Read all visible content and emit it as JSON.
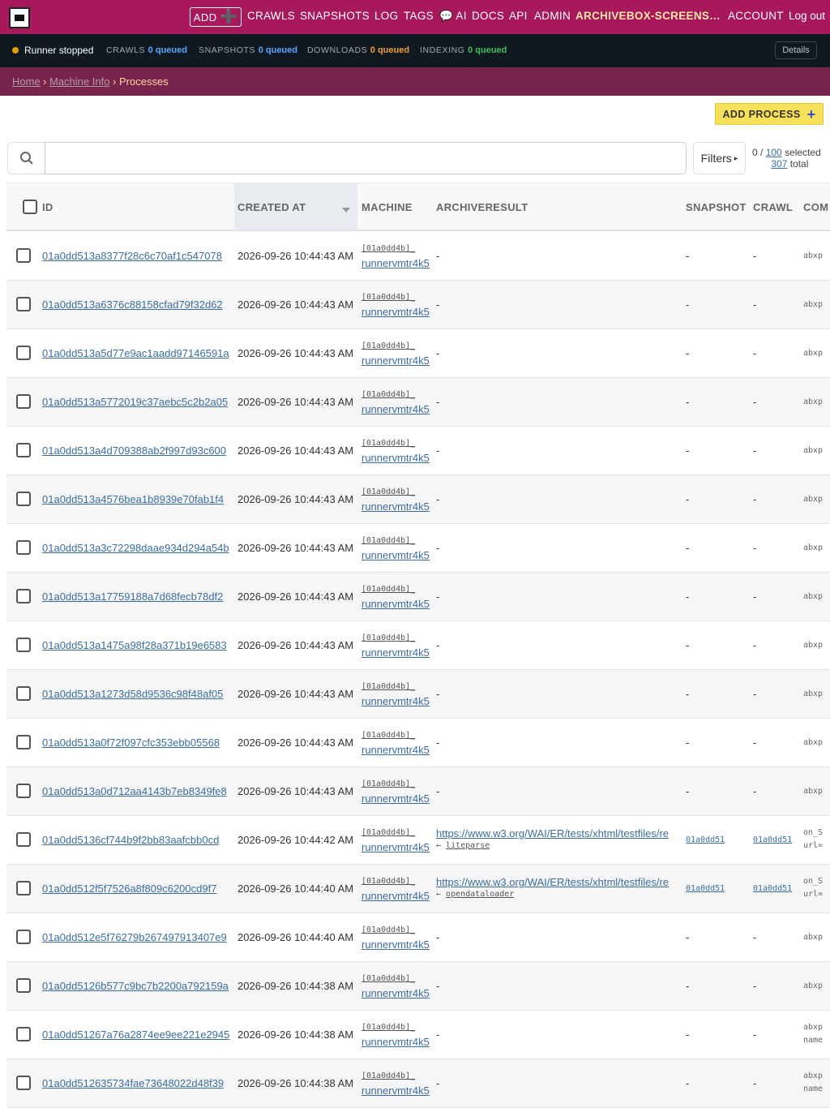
{
  "nav": {
    "add_label": "ADD",
    "add_plus": "➕",
    "links": [
      "CRAWLS",
      "SNAPSHOTS",
      "LOG",
      "TAGS",
      "💬 AI",
      "DOCS",
      "API",
      "ADMIN"
    ],
    "brand": "ARCHIVEBOX-SCREENS…",
    "account": "ACCOUNT",
    "logout": "Log out"
  },
  "status": {
    "runner": "Runner stopped",
    "crawls_label": "CRAWLS",
    "crawls_value": "0 queued",
    "snapshots_label": "SNAPSHOTS",
    "snapshots_value": "0 queued",
    "downloads_label": "DOWNLOADS",
    "downloads_value": "0 queued",
    "indexing_label": "INDEXING",
    "indexing_value": "0 queued",
    "details": "Details"
  },
  "breadcrumb": {
    "home": "Home",
    "sep": "›",
    "machine": "Machine Info",
    "current": "Processes"
  },
  "actions": {
    "add_process": "ADD PROCESS",
    "add_plus": "+"
  },
  "search": {
    "value": "",
    "placeholder": ""
  },
  "filters": {
    "label": "Filters",
    "arrow": "▸"
  },
  "selection": {
    "selected_prefix": "0 /",
    "page_size": "100",
    "selected_suffix": "selected",
    "total": "307",
    "total_suffix": "total"
  },
  "table": {
    "columns": [
      "ID",
      "CREATED AT",
      "MACHINE",
      "ARCHIVERESULT",
      "SNAPSHOT",
      "CRAWL",
      "COM"
    ],
    "rows": [
      {
        "id": "01a0dd513a8377f28c6c70af1c547078",
        "created": "2026-09-26 10:44:43 AM",
        "machine_id": "[01a0dd4b]_",
        "machine_name": "runnervmtr4k5",
        "archiveresult": "-",
        "hook": "",
        "snapshot": "-",
        "crawl": "-",
        "cmd1": "abxp",
        "cmd2": ""
      },
      {
        "id": "01a0dd513a6376c88158cfad79f32d62",
        "created": "2026-09-26 10:44:43 AM",
        "machine_id": "[01a0dd4b]_",
        "machine_name": "runnervmtr4k5",
        "archiveresult": "-",
        "hook": "",
        "snapshot": "-",
        "crawl": "-",
        "cmd1": "abxp",
        "cmd2": ""
      },
      {
        "id": "01a0dd513a5d77e9ac1aadd97146591a",
        "created": "2026-09-26 10:44:43 AM",
        "machine_id": "[01a0dd4b]_",
        "machine_name": "runnervmtr4k5",
        "archiveresult": "-",
        "hook": "",
        "snapshot": "-",
        "crawl": "-",
        "cmd1": "abxp",
        "cmd2": ""
      },
      {
        "id": "01a0dd513a5772019c37aebc5c2b2a05",
        "created": "2026-09-26 10:44:43 AM",
        "machine_id": "[01a0dd4b]_",
        "machine_name": "runnervmtr4k5",
        "archiveresult": "-",
        "hook": "",
        "snapshot": "-",
        "crawl": "-",
        "cmd1": "abxp",
        "cmd2": ""
      },
      {
        "id": "01a0dd513a4d709388ab2f997d93c600",
        "created": "2026-09-26 10:44:43 AM",
        "machine_id": "[01a0dd4b]_",
        "machine_name": "runnervmtr4k5",
        "archiveresult": "-",
        "hook": "",
        "snapshot": "-",
        "crawl": "-",
        "cmd1": "abxp",
        "cmd2": ""
      },
      {
        "id": "01a0dd513a4576bea1b8939e70fab1f4",
        "created": "2026-09-26 10:44:43 AM",
        "machine_id": "[01a0dd4b]_",
        "machine_name": "runnervmtr4k5",
        "archiveresult": "-",
        "hook": "",
        "snapshot": "-",
        "crawl": "-",
        "cmd1": "abxp",
        "cmd2": ""
      },
      {
        "id": "01a0dd513a3c72298daae934d294a54b",
        "created": "2026-09-26 10:44:43 AM",
        "machine_id": "[01a0dd4b]_",
        "machine_name": "runnervmtr4k5",
        "archiveresult": "-",
        "hook": "",
        "snapshot": "-",
        "crawl": "-",
        "cmd1": "abxp",
        "cmd2": ""
      },
      {
        "id": "01a0dd513a17759188a7d68fecb78df2",
        "created": "2026-09-26 10:44:43 AM",
        "machine_id": "[01a0dd4b]_",
        "machine_name": "runnervmtr4k5",
        "archiveresult": "-",
        "hook": "",
        "snapshot": "-",
        "crawl": "-",
        "cmd1": "abxp",
        "cmd2": ""
      },
      {
        "id": "01a0dd513a1475a98f28a371b19e6583",
        "created": "2026-09-26 10:44:43 AM",
        "machine_id": "[01a0dd4b]_",
        "machine_name": "runnervmtr4k5",
        "archiveresult": "-",
        "hook": "",
        "snapshot": "-",
        "crawl": "-",
        "cmd1": "abxp",
        "cmd2": ""
      },
      {
        "id": "01a0dd513a1273d58d9536c98f48af05",
        "created": "2026-09-26 10:44:43 AM",
        "machine_id": "[01a0dd4b]_",
        "machine_name": "runnervmtr4k5",
        "archiveresult": "-",
        "hook": "",
        "snapshot": "-",
        "crawl": "-",
        "cmd1": "abxp",
        "cmd2": ""
      },
      {
        "id": "01a0dd513a0f72f097cfc353ebb05568",
        "created": "2026-09-26 10:44:43 AM",
        "machine_id": "[01a0dd4b]_",
        "machine_name": "runnervmtr4k5",
        "archiveresult": "-",
        "hook": "",
        "snapshot": "-",
        "crawl": "-",
        "cmd1": "abxp",
        "cmd2": ""
      },
      {
        "id": "01a0dd513a0d712aa4143b7eb8349fe8",
        "created": "2026-09-26 10:44:43 AM",
        "machine_id": "[01a0dd4b]_",
        "machine_name": "runnervmtr4k5",
        "archiveresult": "-",
        "hook": "",
        "snapshot": "-",
        "crawl": "-",
        "cmd1": "abxp",
        "cmd2": ""
      },
      {
        "id": "01a0dd5136cf744b9f2bb83aafcbb0cd",
        "created": "2026-09-26 10:44:42 AM",
        "machine_id": "[01a0dd4b]_",
        "machine_name": "runnervmtr4k5",
        "archiveresult": "https://www.w3.org/WAI/ER/tests/xhtml/testfiles/re",
        "hook": "liteparse",
        "snapshot": "01a0dd51",
        "crawl": "01a0dd51",
        "cmd1": "on_S",
        "cmd2": "url="
      },
      {
        "id": "01a0dd512f5f7526a8f809c6200cd9f7",
        "created": "2026-09-26 10:44:40 AM",
        "machine_id": "[01a0dd4b]_",
        "machine_name": "runnervmtr4k5",
        "archiveresult": "https://www.w3.org/WAI/ER/tests/xhtml/testfiles/re",
        "hook": "opendataloader",
        "snapshot": "01a0dd51",
        "crawl": "01a0dd51",
        "cmd1": "on_S",
        "cmd2": "url="
      },
      {
        "id": "01a0dd512e5f76279b267497913407e9",
        "created": "2026-09-26 10:44:40 AM",
        "machine_id": "[01a0dd4b]_",
        "machine_name": "runnervmtr4k5",
        "archiveresult": "-",
        "hook": "",
        "snapshot": "-",
        "crawl": "-",
        "cmd1": "abxp",
        "cmd2": ""
      },
      {
        "id": "01a0dd5126b577c9bc7b2200a792159a",
        "created": "2026-09-26 10:44:38 AM",
        "machine_id": "[01a0dd4b]_",
        "machine_name": "runnervmtr4k5",
        "archiveresult": "-",
        "hook": "",
        "snapshot": "-",
        "crawl": "-",
        "cmd1": "abxp",
        "cmd2": ""
      },
      {
        "id": "01a0dd51267a76a2874ee9ee221e2945",
        "created": "2026-09-26 10:44:38 AM",
        "machine_id": "[01a0dd4b]_",
        "machine_name": "runnervmtr4k5",
        "archiveresult": "-",
        "hook": "",
        "snapshot": "-",
        "crawl": "-",
        "cmd1": "abxp",
        "cmd2": "name"
      },
      {
        "id": "01a0dd512635734fae73648022d48f39",
        "created": "2026-09-26 10:44:38 AM",
        "machine_id": "[01a0dd4b]_",
        "machine_name": "runnervmtr4k5",
        "archiveresult": "-",
        "hook": "",
        "snapshot": "-",
        "crawl": "-",
        "cmd1": "abxp",
        "cmd2": "name"
      }
    ]
  }
}
